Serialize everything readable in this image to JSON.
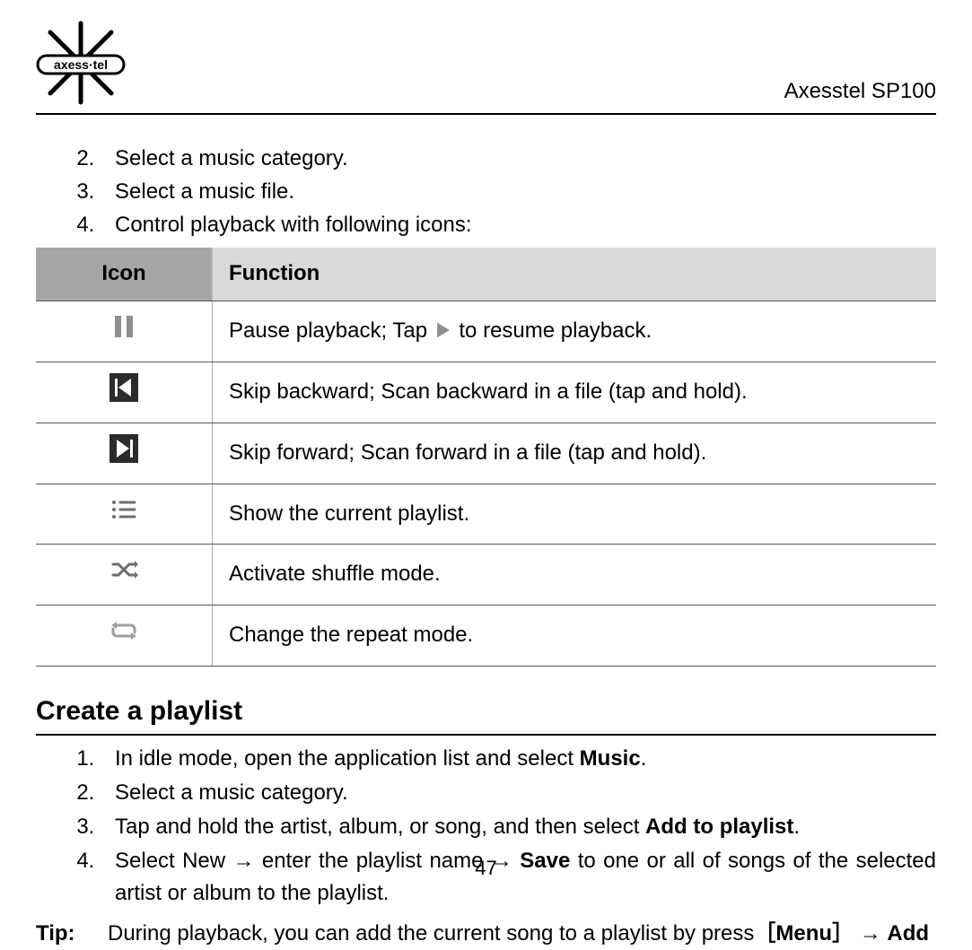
{
  "header": {
    "brand_text": "axess·tel",
    "model": "Axesstel SP100"
  },
  "list1_start": 2,
  "list1": [
    "Select a music category.",
    "Select a music file.",
    "Control playback with following icons:"
  ],
  "table": {
    "head_icon": "Icon",
    "head_function": "Function",
    "rows": [
      {
        "icon": "pause",
        "func_pre": "Pause playback; Tap ",
        "func_mid_icon": "play-inline",
        "func_post": " to resume playback."
      },
      {
        "icon": "prev",
        "func_pre": "Skip backward; Scan backward in a file (tap and hold).",
        "func_mid_icon": "",
        "func_post": ""
      },
      {
        "icon": "next",
        "func_pre": "Skip forward; Scan forward in a file (tap and hold).",
        "func_mid_icon": "",
        "func_post": ""
      },
      {
        "icon": "playlist",
        "func_pre": "Show the current playlist.",
        "func_mid_icon": "",
        "func_post": ""
      },
      {
        "icon": "shuffle",
        "func_pre": "Activate shuffle mode.",
        "func_mid_icon": "",
        "func_post": ""
      },
      {
        "icon": "repeat",
        "func_pre": "Change the repeat mode.",
        "func_mid_icon": "",
        "func_post": ""
      }
    ]
  },
  "section2_title": "Create a playlist",
  "list2_start": 1,
  "list2": [
    {
      "parts": [
        "In idle mode, open the application list and select ",
        {
          "b": "Music"
        },
        "."
      ]
    },
    {
      "parts": [
        "Select a music category."
      ]
    },
    {
      "parts": [
        "Tap and hold the artist, album, or song, and then select ",
        {
          "b": "Add to playlist"
        },
        "."
      ]
    },
    {
      "parts": [
        "Select New  →  enter the playlist name  →  ",
        {
          "b": "Save"
        },
        " to one or all of songs of the selected artist or album to the playlist."
      ]
    }
  ],
  "tip": {
    "label": "Tip:",
    "parts": [
      "During playback, you can add the current song to a playlist by press",
      {
        "b": "［Menu］"
      },
      "  →  ",
      {
        "b": "Add"
      }
    ]
  },
  "page_number": "47"
}
